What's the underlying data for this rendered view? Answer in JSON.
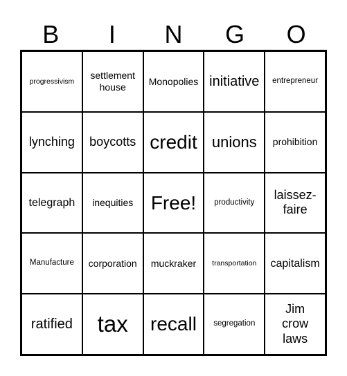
{
  "header": {
    "letters": [
      "B",
      "I",
      "N",
      "G",
      "O"
    ]
  },
  "cells": [
    [
      "progressivism",
      "settlement house",
      "Monopolies",
      "initiative",
      "entrepreneur"
    ],
    [
      "lynching",
      "boycotts",
      "credit",
      "unions",
      "prohibition"
    ],
    [
      "telegraph",
      "inequities",
      "Free!",
      "productivity",
      "laissez-faire"
    ],
    [
      "Manufacture",
      "corporation",
      "muckraker",
      "transportation",
      "capitalism"
    ],
    [
      "ratified",
      "tax",
      "recall",
      "segregation",
      "Jim crow laws"
    ]
  ]
}
